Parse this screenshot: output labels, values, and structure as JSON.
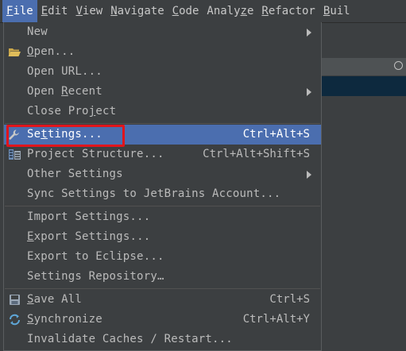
{
  "menubar": {
    "items": [
      {
        "mn": "F",
        "rest": "ile"
      },
      {
        "mn": "E",
        "rest": "dit"
      },
      {
        "mn": "V",
        "rest": "iew"
      },
      {
        "mn": "N",
        "rest": "avigate"
      },
      {
        "mn": "C",
        "rest": "ode"
      },
      {
        "pre": "Analy",
        "mn": "z",
        "rest": "e"
      },
      {
        "mn": "R",
        "rest": "efactor"
      },
      {
        "mn": "B",
        "rest": "uil"
      }
    ]
  },
  "file_menu": {
    "new": "New",
    "open": {
      "mn": "O",
      "rest": "pen..."
    },
    "open_url": "Open URL...",
    "open_recent": {
      "pre": "Open ",
      "mn": "R",
      "rest": "ecent"
    },
    "close_project": {
      "pre": "Close Pro",
      "mn": "j",
      "rest": "ect"
    },
    "settings": {
      "pre": "Se",
      "mn": "t",
      "rest": "tings..."
    },
    "settings_shortcut": "Ctrl+Alt+S",
    "project_structure": "Project Structure...",
    "project_structure_shortcut": "Ctrl+Alt+Shift+S",
    "other_settings": "Other Settings",
    "sync_settings": "Sync Settings to JetBrains Account...",
    "import_settings": "Import Settings...",
    "export_settings": {
      "mn": "E",
      "rest": "xport Settings..."
    },
    "export_eclipse": "Export to Eclipse...",
    "settings_repository": "Settings Repository…",
    "save_all": {
      "mn": "S",
      "rest": "ave All"
    },
    "save_all_shortcut": "Ctrl+S",
    "synchronize": {
      "mn": "S",
      "rest": "ynchronize"
    },
    "synchronize_shortcut": "Ctrl+Alt+Y",
    "invalidate_caches": "Invalidate Caches / Restart..."
  }
}
